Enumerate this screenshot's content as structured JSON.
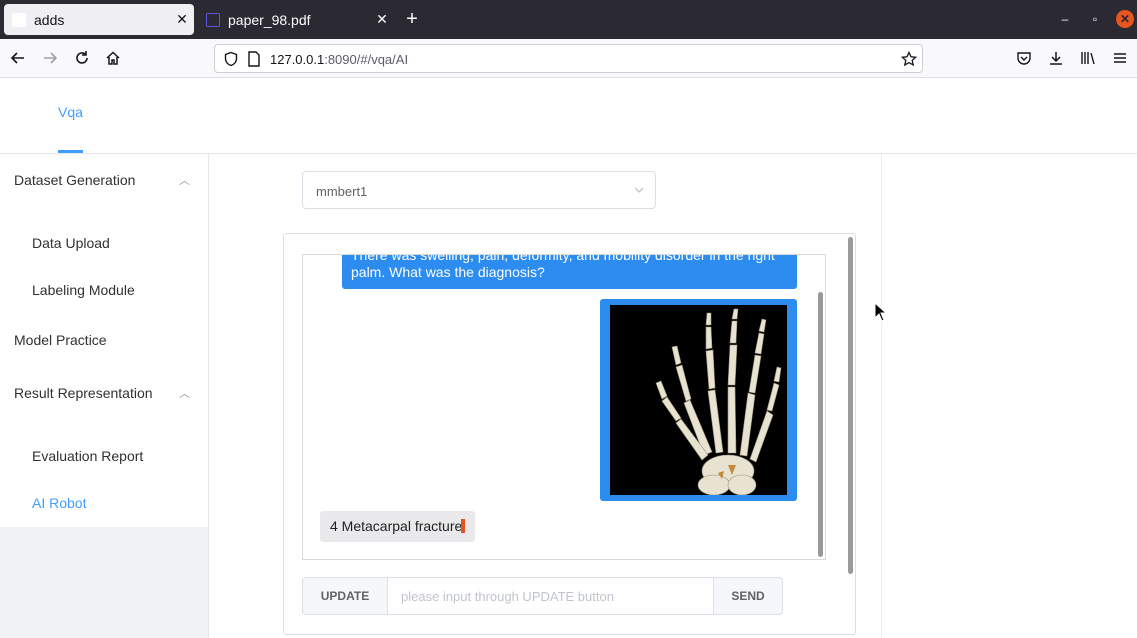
{
  "browser": {
    "tabs": [
      {
        "title": "adds",
        "active": true
      },
      {
        "title": "paper_98.pdf",
        "active": false
      }
    ],
    "new_tab_label": "+",
    "url_host": "127.0.0.1",
    "url_rest": ":8090/#/vqa/AI"
  },
  "app": {
    "nav": {
      "vqa_label": "Vqa"
    },
    "sidebar": {
      "dataset_generation": "Dataset Generation",
      "data_upload": "Data Upload",
      "labeling_module": "Labeling Module",
      "model_practice": "Model Practice",
      "result_representation": "Result Representation",
      "evaluation_report": "Evaluation Report",
      "ai_robot": "AI Robot"
    },
    "model_select": {
      "value": "mmbert1"
    },
    "chat": {
      "question": "There was swelling, pain, deformity, and mobility disorder in the right palm. What was the diagnosis?",
      "image_alt": "3D CT rendering of right hand bones",
      "answer": "4 Metacarpal fracture"
    },
    "input": {
      "update_label": "UPDATE",
      "placeholder": "please input through UPDATE button",
      "value": "",
      "send_label": "SEND"
    }
  },
  "colors": {
    "accent": "#409eff",
    "bubble_blue": "#2d8cf0",
    "tabbar_bg": "#2b2a33"
  },
  "icons": [
    "back-icon",
    "forward-icon",
    "reload-icon",
    "home-icon",
    "shield-icon",
    "page-icon",
    "bookmark-star-icon",
    "pocket-icon",
    "download-icon",
    "library-icon",
    "menu-icon",
    "chevron-up-icon",
    "chevron-down-icon",
    "close-icon",
    "minimize-icon",
    "restore-icon",
    "mouse-pointer-icon"
  ]
}
